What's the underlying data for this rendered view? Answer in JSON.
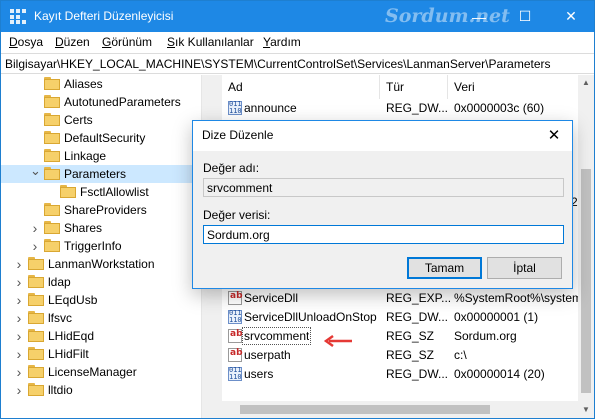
{
  "window": {
    "title": "Kayıt Defteri Düzenleyicisi",
    "watermark": "Sordum.net",
    "minimize_glyph": "—",
    "maximize_glyph": "☐",
    "close_glyph": "✕"
  },
  "menu": {
    "items": [
      "Dosya",
      "Düzen",
      "Görünüm",
      "Sık Kullanılanlar",
      "Yardım"
    ]
  },
  "address": "Bilgisayar\\HKEY_LOCAL_MACHINE\\SYSTEM\\CurrentControlSet\\Services\\LanmanServer\\Parameters",
  "tree": {
    "items": [
      {
        "label": "Aliases",
        "chevron": ""
      },
      {
        "label": "AutotunedParameters",
        "chevron": ""
      },
      {
        "label": "Certs",
        "chevron": ""
      },
      {
        "label": "DefaultSecurity",
        "chevron": ""
      },
      {
        "label": "Linkage",
        "chevron": ""
      },
      {
        "label": "Parameters",
        "chevron": "v",
        "selected": true
      },
      {
        "label": "FsctlAllowlist",
        "chevron": ""
      },
      {
        "label": "ShareProviders",
        "chevron": ""
      },
      {
        "label": "Shares",
        "chevron": ">"
      },
      {
        "label": "TriggerInfo",
        "chevron": ">"
      },
      {
        "label": "LanmanWorkstation",
        "chevron": ">"
      },
      {
        "label": "ldap",
        "chevron": ">"
      },
      {
        "label": "LEqdUsb",
        "chevron": ">"
      },
      {
        "label": "lfsvc",
        "chevron": ">"
      },
      {
        "label": "LHidEqd",
        "chevron": ">"
      },
      {
        "label": "LHidFilt",
        "chevron": ">"
      },
      {
        "label": "LicenseManager",
        "chevron": ">"
      },
      {
        "label": "lltdio",
        "chevron": ">"
      }
    ]
  },
  "list": {
    "columns": [
      "Ad",
      "Tür",
      "Veri"
    ],
    "rows": [
      {
        "icon": "binary-value-icon",
        "name": "announce",
        "type": "REG_DW...",
        "data": "0x0000003c (60)"
      },
      {
        "icon": "string-value-icon",
        "name": "ServiceDll",
        "type": "REG_EXP...",
        "data": "%SystemRoot%\\system"
      },
      {
        "icon": "binary-value-icon",
        "name": "ServiceDllUnloadOnStop",
        "type": "REG_DW...",
        "data": "0x00000001 (1)"
      },
      {
        "icon": "string-value-icon",
        "name": "srvcomment",
        "type": "REG_SZ",
        "data": "Sordum.org",
        "selected": true
      },
      {
        "icon": "string-value-icon",
        "name": "userpath",
        "type": "REG_SZ",
        "data": "c:\\"
      },
      {
        "icon": "binary-value-icon",
        "name": "users",
        "type": "REG_DW...",
        "data": "0x00000014 (20)"
      }
    ],
    "partial_right_glyph": "2"
  },
  "dialog": {
    "title": "Dize Düzenle",
    "close_glyph": "✕",
    "name_label": "Değer adı:",
    "name_value": "srvcomment",
    "data_label": "Değer verisi:",
    "data_value": "Sordum.org",
    "ok_label": "Tamam",
    "cancel_label": "İptal"
  },
  "colors": {
    "titlebar": "#1e88e5",
    "selection": "#cce8ff",
    "arrow": "#e53935"
  }
}
